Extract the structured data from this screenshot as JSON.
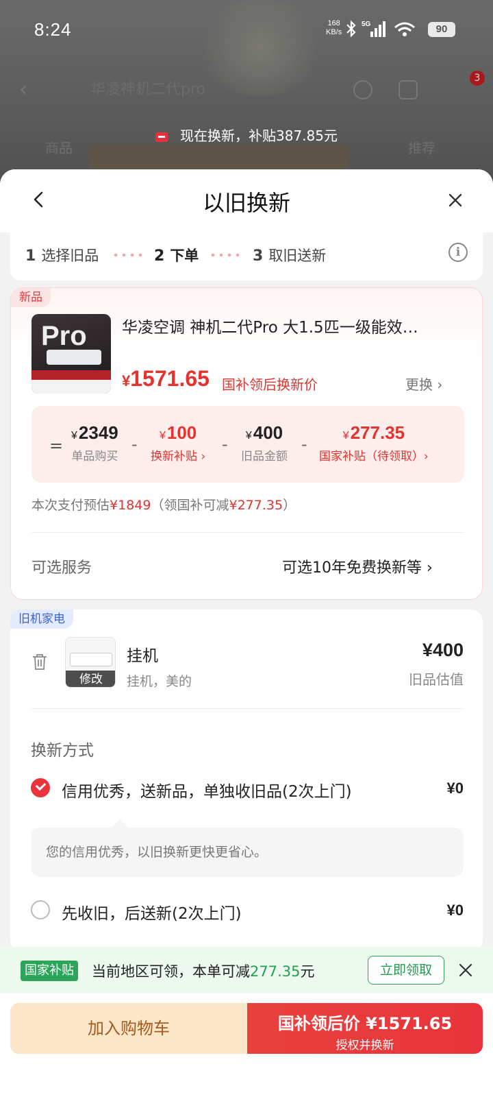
{
  "status": {
    "time": "8:24",
    "net_speed": "168",
    "net_unit": "KB/s",
    "signal_label": "5G",
    "battery": "90"
  },
  "background_page": {
    "search_text": "华凌神机二代pro",
    "cart_badge": "3",
    "tab_left": "商品",
    "tab_right": "推荐"
  },
  "promo": {
    "text": "现在换新，补贴387.85元"
  },
  "sheet": {
    "title": "以旧换新"
  },
  "steps": [
    {
      "num": "1",
      "label": "选择旧品"
    },
    {
      "num": "2",
      "label": "下单"
    },
    {
      "num": "3",
      "label": "取旧送新"
    }
  ],
  "new_item": {
    "tag": "新品",
    "image_text": "Pro",
    "name": "华凌空调 神机二代Pro 大1.5匹一级能效…",
    "price_symbol": "¥",
    "price": "1571.65",
    "price_label": "国补领后换新价",
    "swap_label": "更换",
    "breakdown": {
      "equals": "=",
      "minus": "-",
      "items": [
        {
          "symbol": "¥",
          "value": "2349",
          "label": "单品购买"
        },
        {
          "symbol": "¥",
          "value": "100",
          "label": "换新补贴 ›"
        },
        {
          "symbol": "¥",
          "value": "400",
          "label": "旧品金额"
        },
        {
          "symbol": "¥",
          "value": "277.35",
          "label": "国家补贴（待领取）›"
        }
      ]
    },
    "estimate_prefix": "本次支付预估",
    "estimate_value": "¥1849",
    "estimate_mid": "（领国补可减",
    "estimate_reduce": "¥277.35",
    "estimate_suffix": "）",
    "service_label": "可选服务",
    "service_value": "可选10年免费换新等"
  },
  "old_item": {
    "tag": "旧机家电",
    "edit_label": "修改",
    "name": "挂机",
    "sub": "挂机，美的",
    "price": "¥400",
    "price_label": "旧品估值",
    "method_title": "换新方式",
    "options": [
      {
        "label": "信用优秀，送新品，单独收旧品(2次上门)",
        "price": "¥0",
        "selected": true
      },
      {
        "label": "先收旧，后送新(2次上门)",
        "price": "¥0",
        "selected": false
      }
    ],
    "tip": "您的信用优秀，以旧换新更快更省心。"
  },
  "subsidy_bar": {
    "tag": "国家补贴",
    "text_prefix": "当前地区可领，本单可减",
    "amount": "277.35",
    "text_suffix": "元",
    "claim_label": "立即领取"
  },
  "actions": {
    "cart_label": "加入购物车",
    "buy_main": "国补领后价 ¥1571.65",
    "buy_sub": "授权并换新"
  },
  "colors": {
    "accent_red": "#e3332e",
    "green": "#2aa55a",
    "cart_bg": "#fbe6c9"
  }
}
